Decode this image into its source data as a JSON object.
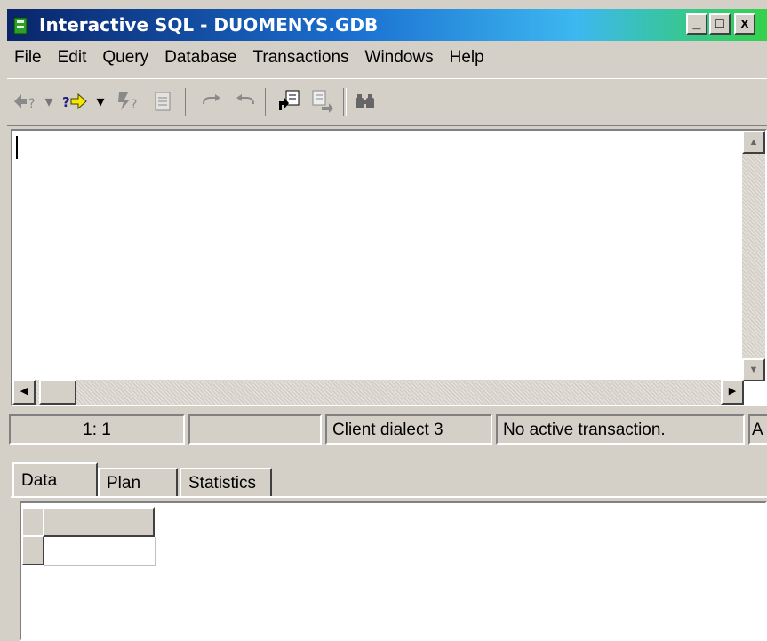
{
  "window": {
    "title": "Interactive SQL - DUOMENYS.GDB",
    "controls": {
      "minimize": "_",
      "maximize": "□",
      "close": "x"
    }
  },
  "menu": [
    "File",
    "Edit",
    "Query",
    "Database",
    "Transactions",
    "Windows",
    "Help"
  ],
  "toolbar": {
    "icons": [
      "query-prev-icon",
      "dropdown-icon",
      "query-next-icon",
      "dropdown-icon",
      "execute-icon",
      "notepad-icon",
      "commit-icon",
      "rollback-icon",
      "load-script-icon",
      "save-script-icon",
      "find-icon"
    ]
  },
  "status": {
    "position": "1: 1",
    "empty": "",
    "dialect": "Client dialect 3",
    "transaction": "No active transaction.",
    "extra": "A"
  },
  "tabs": [
    "Data",
    "Plan",
    "Statistics"
  ],
  "active_tab": "Data"
}
